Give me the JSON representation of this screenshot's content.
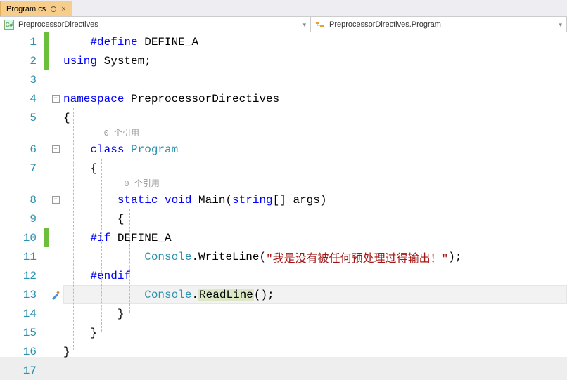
{
  "tab": {
    "name": "Program.cs"
  },
  "nav": {
    "left": "PreprocessorDirectives",
    "right": "PreprocessorDirectives.Program"
  },
  "hints": {
    "refs": "0 个引用"
  },
  "code": {
    "l1_def": "#define",
    "l1_sym": " DEFINE_A",
    "l2_using": "using",
    "l2_sys": " System",
    "l2_semi": ";",
    "l4_ns": "namespace",
    "l4_name": " PreprocessorDirectives",
    "l5_ob": "{",
    "l6_class": "class",
    "l6_name": " Program",
    "l7_ob": "    {",
    "l8_static": "static",
    "l8_void": "void",
    "l8_main": " Main(",
    "l8_str": "string",
    "l8_args": "[] args)",
    "l9_ob": "        {",
    "l10_if": "#if",
    "l10_sym": " DEFINE_A",
    "l11_cons": "Console",
    "l11_wl": ".WriteLine(",
    "l11_str": "\"我是没有被任何预处理过得输出！\"",
    "l11_end": ");",
    "l12_endif": "#endif",
    "l13_cons": "Console",
    "l13_dot": ".",
    "l13_rl": "ReadLine",
    "l13_end": "();",
    "l14_cb": "        }",
    "l15_cb": "    }",
    "l16_cb": "}"
  },
  "lines": [
    "1",
    "2",
    "3",
    "4",
    "5",
    "6",
    "7",
    "8",
    "9",
    "10",
    "11",
    "12",
    "13",
    "14",
    "15",
    "16",
    "17"
  ]
}
